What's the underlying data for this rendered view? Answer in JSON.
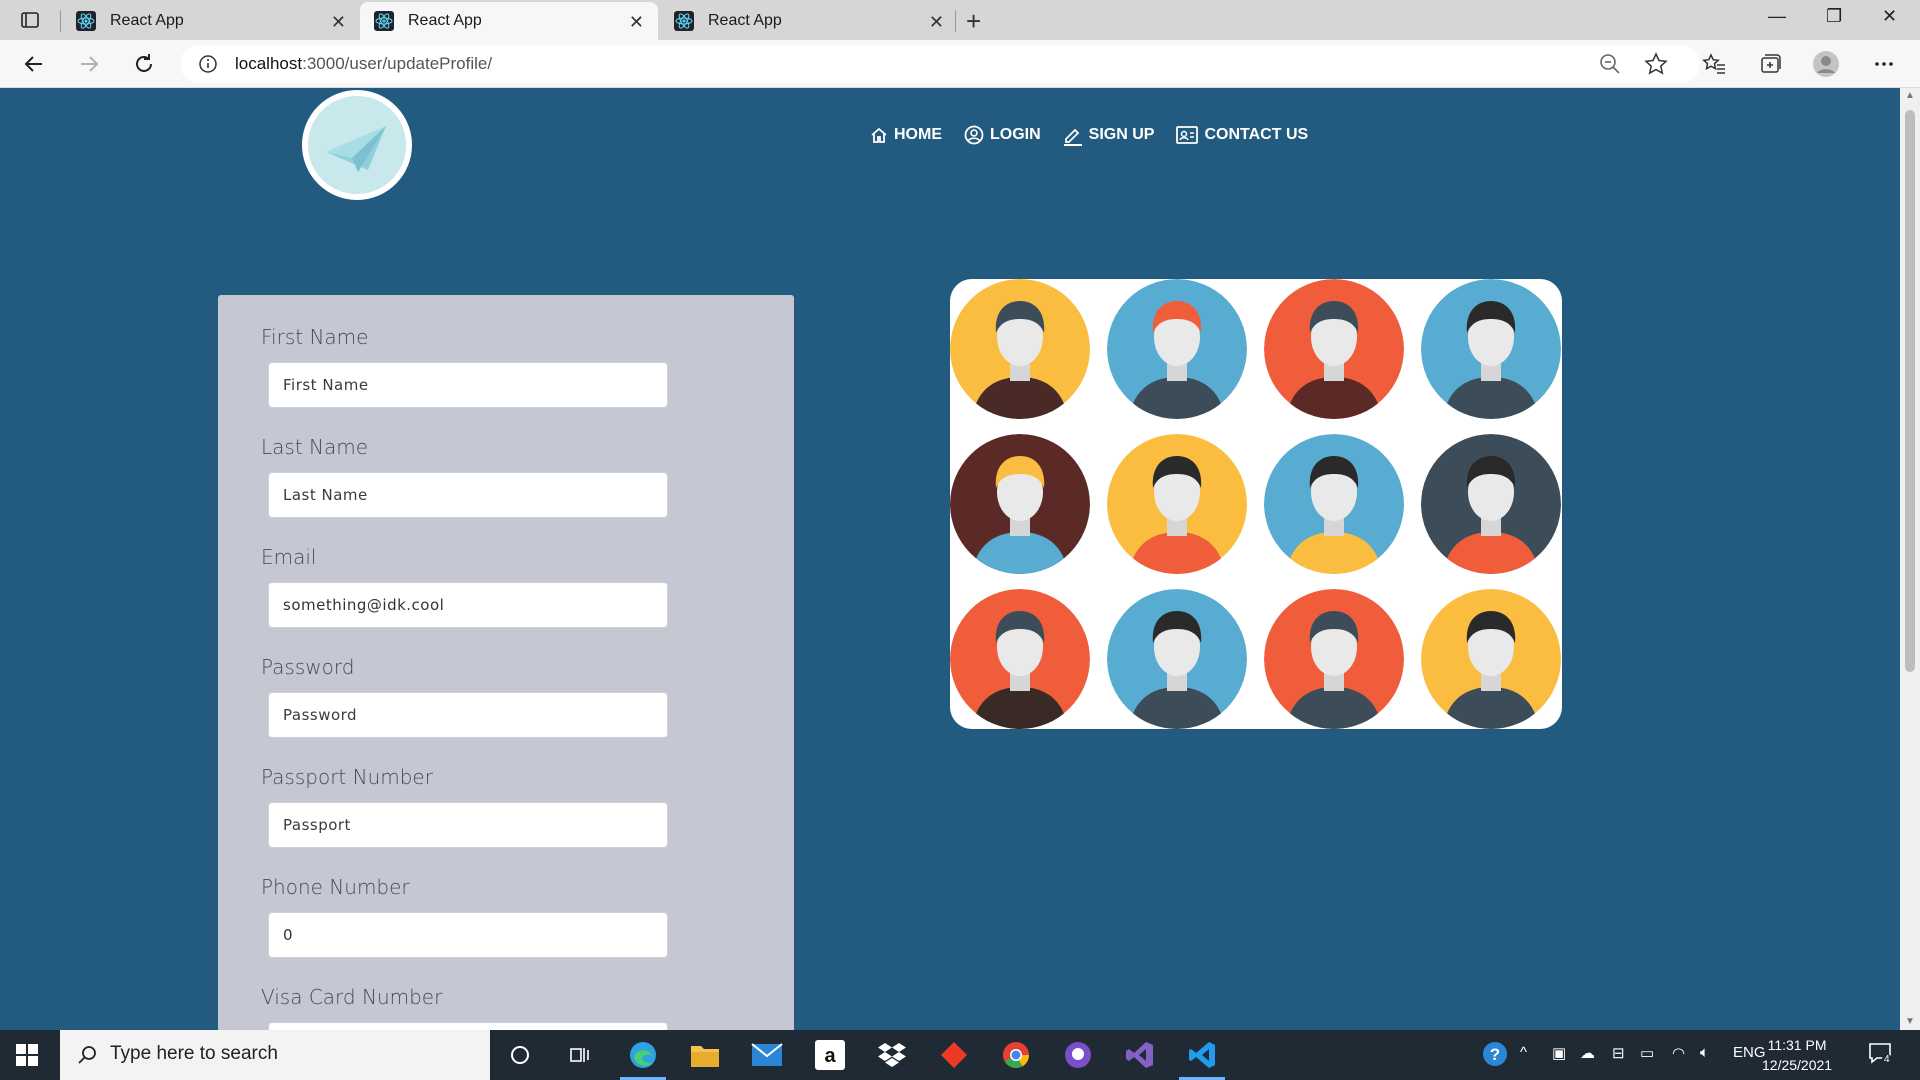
{
  "browser": {
    "tabs": [
      {
        "title": "React App",
        "active": false
      },
      {
        "title": "React App",
        "active": true
      },
      {
        "title": "React App",
        "active": false
      }
    ],
    "url_host": "localhost",
    "url_rest": ":3000/user/updateProfile/"
  },
  "nav": {
    "items": [
      {
        "label": "HOME",
        "icon": "home-icon"
      },
      {
        "label": "LOGIN",
        "icon": "user-circle-icon"
      },
      {
        "label": "SIGN UP",
        "icon": "edit-icon"
      },
      {
        "label": "CONTACT US",
        "icon": "contact-card-icon"
      }
    ]
  },
  "form": {
    "fields": [
      {
        "label": "First Name",
        "placeholder": "First Name",
        "value": ""
      },
      {
        "label": "Last Name",
        "placeholder": "Last Name",
        "value": ""
      },
      {
        "label": "Email",
        "placeholder": "",
        "value": "something@idk.cool"
      },
      {
        "label": "Password",
        "placeholder": "Password",
        "value": ""
      },
      {
        "label": "Passport Number",
        "placeholder": "Passport",
        "value": ""
      },
      {
        "label": "Phone Number",
        "placeholder": "",
        "value": "0"
      },
      {
        "label": "Visa Card Number",
        "placeholder": "",
        "value": ""
      }
    ]
  },
  "colors": {
    "page_bg": "#235a80",
    "panel_bg": "#c5c7d2",
    "avatar_yellow": "#fbbd3f",
    "avatar_blue": "#58acd2",
    "avatar_red": "#ef5d3a",
    "avatar_brown": "#5c2a26",
    "avatar_slate": "#3c4d59"
  },
  "taskbar": {
    "search_placeholder": "Type here to search",
    "language": "ENG",
    "time": "11:31 PM",
    "date": "12/25/2021",
    "notifications": "4"
  }
}
